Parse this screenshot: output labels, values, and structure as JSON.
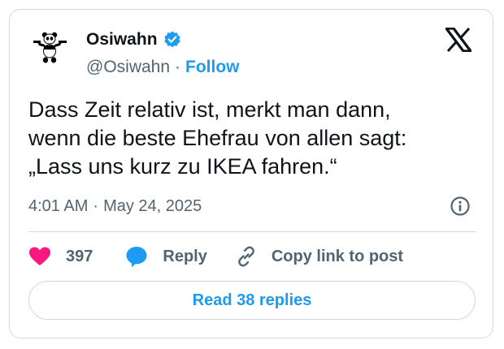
{
  "author": {
    "display_name": "Osiwahn",
    "handle": "@Osiwahn",
    "separator": "·",
    "follow_label": "Follow",
    "verified": true
  },
  "tweet": {
    "text": "Dass Zeit relativ ist, merkt man dann,\nwenn die beste Ehefrau von allen sagt:\n„Lass uns kurz zu IKEA fahren.“",
    "time": "4:01 AM",
    "separator": "·",
    "date": "May 24, 2025"
  },
  "actions": {
    "like_count": "397",
    "reply_label": "Reply",
    "copy_label": "Copy link to post"
  },
  "read_replies_label": "Read 38 replies",
  "colors": {
    "accent": "#1d9bf0",
    "like": "#f91880",
    "text_primary": "#0f1419",
    "text_secondary": "#536471",
    "border": "#cfd9de"
  },
  "icons": {
    "avatar": "panda-avatar",
    "verified": "verified-badge-icon",
    "logo": "x-logo-icon",
    "info": "info-icon",
    "like": "heart-icon",
    "reply": "speech-bubble-icon",
    "copy": "link-icon"
  }
}
